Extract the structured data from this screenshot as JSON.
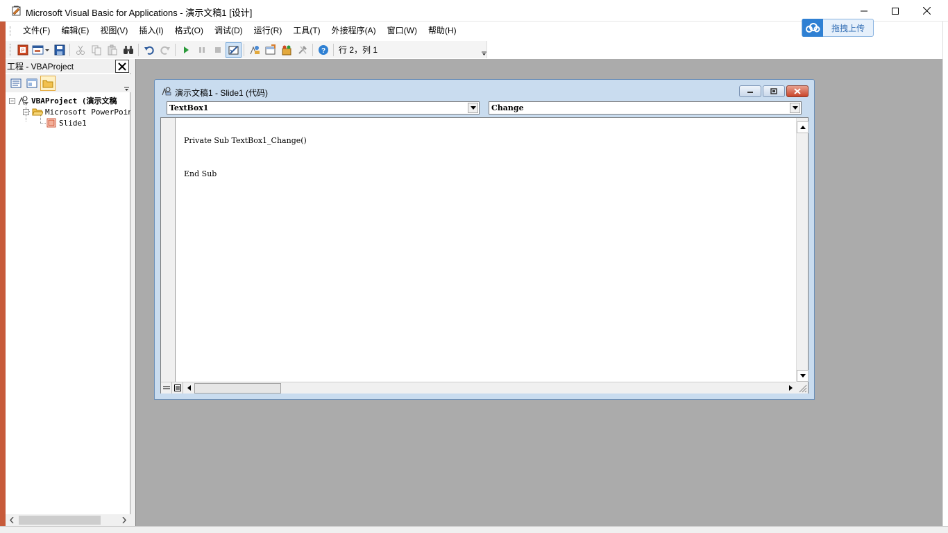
{
  "window": {
    "title": "Microsoft Visual Basic for Applications - 演示文稿1 [设计]"
  },
  "menu": {
    "items": [
      "文件(F)",
      "编辑(E)",
      "视图(V)",
      "插入(I)",
      "格式(O)",
      "调试(D)",
      "运行(R)",
      "工具(T)",
      "外接程序(A)",
      "窗口(W)",
      "帮助(H)"
    ]
  },
  "upload": {
    "label": "拖拽上传"
  },
  "toolbar": {
    "status": "行 2，列 1"
  },
  "project_panel": {
    "title": "工程 - VBAProject",
    "tree": {
      "root": "VBAProject (演示文稿",
      "folder": "Microsoft PowerPoint",
      "item": "Slide1"
    }
  },
  "code_window": {
    "title": "演示文稿1 - Slide1 (代码)",
    "object_combo": "TextBox1",
    "procedure_combo": "Change",
    "code_lines": [
      "Private Sub TextBox1_Change()",
      "End Sub"
    ]
  },
  "colors": {
    "accent": "#c75a3a",
    "workspace": "#ababab",
    "code_window_frame": "#c9dcef"
  }
}
